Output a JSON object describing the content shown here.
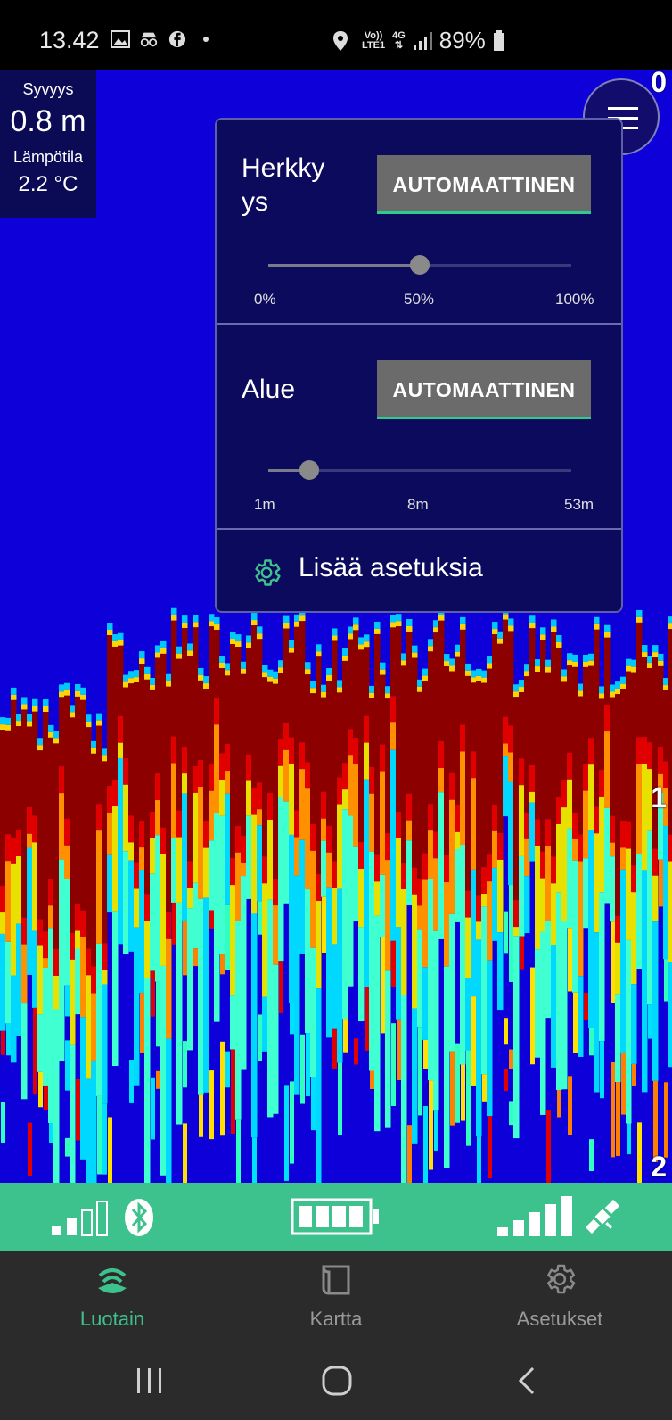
{
  "status_bar": {
    "time": "13.42",
    "network_top": "Vo))",
    "network_bottom": "LTE1",
    "network_type": "4G",
    "battery": "89%"
  },
  "readout": {
    "depth_label": "Syvyys",
    "depth_value": "0.8 m",
    "temp_label": "Lämpötila",
    "temp_value": "2.2 °C"
  },
  "depth_scale": {
    "top": "0",
    "middle": "1",
    "bottom": "2"
  },
  "settings_panel": {
    "sensitivity": {
      "label": "Herkky\nys",
      "button": "AUTOMAATTINEN",
      "ticks": [
        "0%",
        "50%",
        "100%"
      ],
      "value_fraction": 0.5
    },
    "range": {
      "label": "Alue",
      "button": "AUTOMAATTINEN",
      "ticks": [
        "1m",
        "8m",
        "53m"
      ],
      "value_fraction": 0.135
    },
    "more_settings": "Lisää asetuksia"
  },
  "status_strip": {
    "bluetooth_signal_bars": 2,
    "battery_cells": 4,
    "gps_signal_bars": 5
  },
  "bottom_nav": {
    "items": [
      {
        "label": "Luotain",
        "icon": "sonar-icon",
        "active": true
      },
      {
        "label": "Kartta",
        "icon": "map-icon",
        "active": false
      },
      {
        "label": "Asetukset",
        "icon": "gear-icon",
        "active": false
      }
    ]
  },
  "colors": {
    "accent": "#3ec28d",
    "sonar_background": "#0d00d8",
    "panel": "#0c0a5c"
  }
}
